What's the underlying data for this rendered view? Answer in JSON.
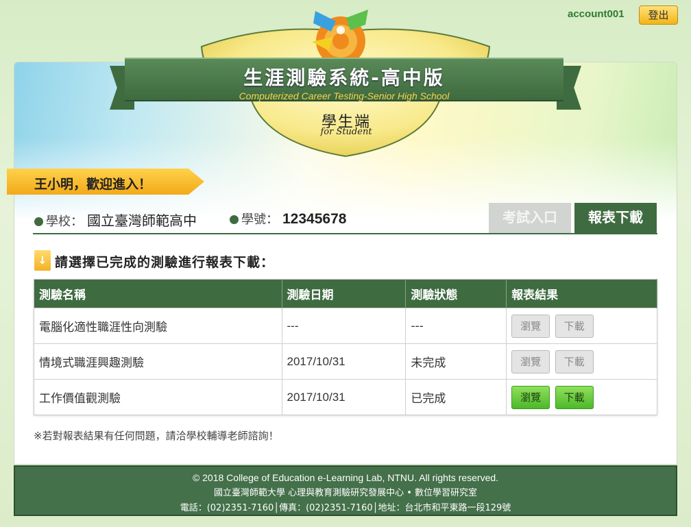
{
  "header": {
    "account": "account001",
    "logout_label": "登出"
  },
  "banner": {
    "title": "生涯測驗系統-高中版",
    "subtitle": "Computerized Career Testing-Senior High School",
    "role_zh": "學生端",
    "role_en": "for Student"
  },
  "welcome": "王小明，歡迎進入！",
  "info": {
    "school_label": "學校：",
    "school_value": "國立臺灣師範高中",
    "id_label": "學號：",
    "id_value": "12345678"
  },
  "tabs": {
    "exam": "考試入口",
    "report": "報表下載"
  },
  "instruction": "請選擇已完成的測驗進行報表下載：",
  "table": {
    "headers": [
      "測驗名稱",
      "測驗日期",
      "測驗狀態",
      "報表結果"
    ],
    "rows": [
      {
        "name": "電腦化適性職涯性向測驗",
        "date": "---",
        "status": "---",
        "enabled": false
      },
      {
        "name": "情境式職涯興趣測驗",
        "date": "2017/10/31",
        "status": "未完成",
        "enabled": false
      },
      {
        "name": "工作價值觀測驗",
        "date": "2017/10/31",
        "status": "已完成",
        "enabled": true
      }
    ],
    "browse_label": "瀏覽",
    "download_label": "下載"
  },
  "note": "※若對報表結果有任何問題，請洽學校輔導老師諮詢！",
  "footer": {
    "line1": "© 2018 College of Education e-Learning Lab, NTNU. All rights reserved.",
    "line2": "國立臺灣師範大學 心理與教育測驗研究發展中心 • 數位學習研究室",
    "line3": "電話：(02)2351-7160│傳真：(02)2351-7160│地址：台北市和平東路一段129號"
  },
  "colors": {
    "brand_green": "#3f6b40",
    "accent_yellow": "#f2a91a",
    "button_green": "#4db82a"
  }
}
